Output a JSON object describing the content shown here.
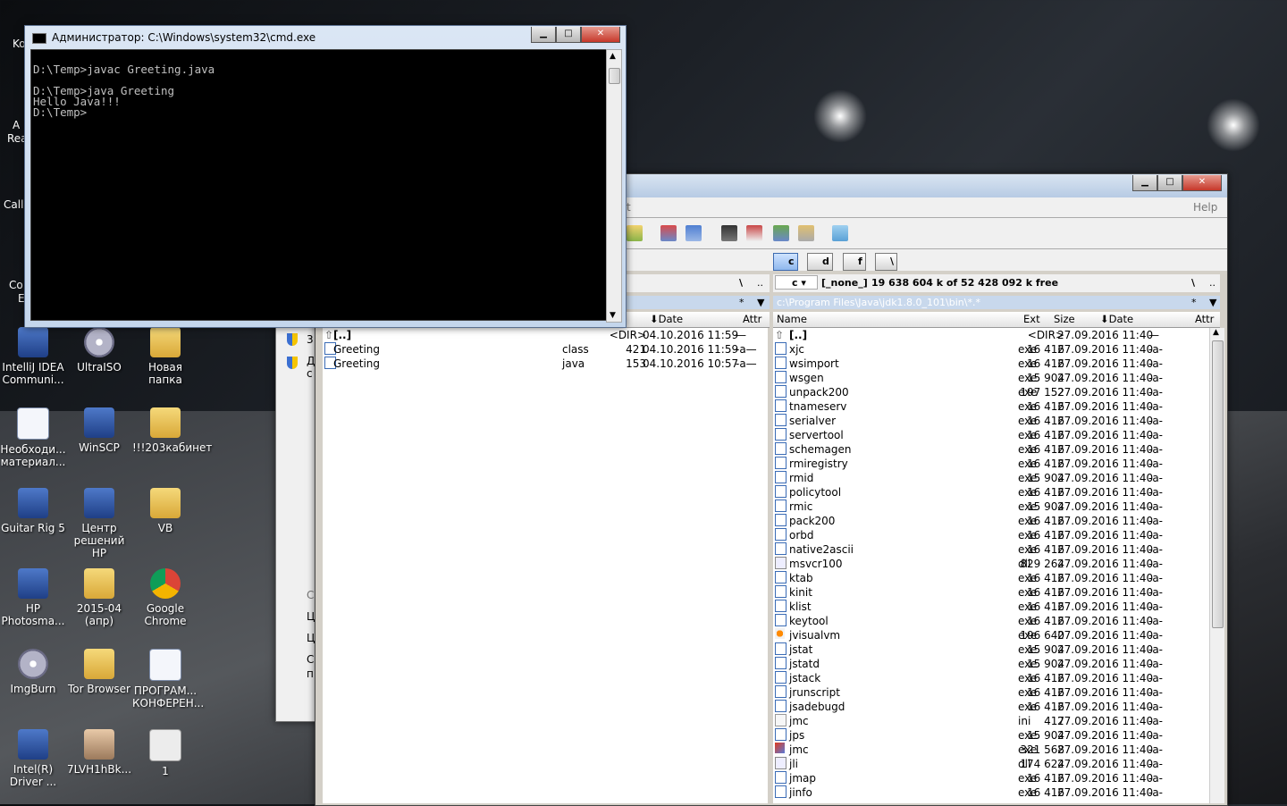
{
  "desktop": {
    "icons": [
      {
        "label": "IntelliJ IDEA Communi...",
        "kind": "app"
      },
      {
        "label": "UltraISO",
        "kind": "disc"
      },
      {
        "label": "Новая папка",
        "kind": "folder"
      },
      {
        "label": "Необходи... материал...",
        "kind": "doc"
      },
      {
        "label": "WinSCP",
        "kind": "app"
      },
      {
        "label": "!!!203кабинет",
        "kind": "folder"
      },
      {
        "label": "Guitar Rig 5",
        "kind": "app"
      },
      {
        "label": "Центр решений HP",
        "kind": "app"
      },
      {
        "label": "VB",
        "kind": "folder"
      },
      {
        "label": "HP Photosma...",
        "kind": "app"
      },
      {
        "label": "2015-04 (апр)",
        "kind": "folder"
      },
      {
        "label": "Google Chrome",
        "kind": "chrome"
      },
      {
        "label": "ImgBurn",
        "kind": "disc"
      },
      {
        "label": "Tor Browser",
        "kind": "folder"
      },
      {
        "label": "ПРОГРАМ... КОНФЕРЕН...",
        "kind": "doc"
      },
      {
        "label": "Intel(R) Driver ...",
        "kind": "app"
      },
      {
        "label": "7LVH1hBk...",
        "kind": "person"
      },
      {
        "label": "1",
        "kind": "mail"
      }
    ],
    "partial_labels": [
      "Ko",
      "A",
      "Rea",
      "Call",
      "Co",
      "E"
    ]
  },
  "cmd": {
    "title": "Администратор: C:\\Windows\\system32\\cmd.exe",
    "output": "D:\\Temp>javac Greeting.java\n\nD:\\Temp>java Greeting\nHello Java!!!\nD:\\Temp>"
  },
  "total_commander": {
    "menu_help": "Help",
    "menu_partial": "t",
    "drives": [
      "c",
      "d",
      "f",
      "\\"
    ],
    "right_drive": {
      "letter": "c",
      "label": "[_none_]",
      "free_text": "19 638 604 k of 52 428 092 k free"
    },
    "right_path": "c:\\Program Files\\Java\\jdk1.8.0_101\\bin\\*.*",
    "nav_root": "\\",
    "nav_up": "..",
    "filter_star": "*",
    "columns": {
      "name": "Name",
      "ext": "Ext",
      "size": "Size",
      "date": "Date",
      "attr": "Attr"
    },
    "left_files": [
      {
        "name": "[..]",
        "ext": "",
        "size": "<DIR>",
        "date": "04.10.2016 11:59",
        "attr": "—",
        "icon": "up"
      },
      {
        "name": "Greeting",
        "ext": "class",
        "size": "421",
        "date": "04.10.2016 11:59",
        "attr": "-a—",
        "icon": "file"
      },
      {
        "name": "Greeting",
        "ext": "java",
        "size": "153",
        "date": "04.10.2016 10:57",
        "attr": "-a—",
        "icon": "file"
      }
    ],
    "right_files": [
      {
        "name": "[..]",
        "ext": "",
        "size": "<DIR>",
        "date": "27.09.2016 11:40",
        "attr": "—",
        "icon": "up"
      },
      {
        "name": "xjc",
        "ext": "exe",
        "size": "16 416",
        "date": "27.09.2016 11:40",
        "attr": "-a-",
        "icon": "file"
      },
      {
        "name": "wsimport",
        "ext": "exe",
        "size": "16 416",
        "date": "27.09.2016 11:40",
        "attr": "-a-",
        "icon": "file"
      },
      {
        "name": "wsgen",
        "ext": "exe",
        "size": "15 904",
        "date": "27.09.2016 11:40",
        "attr": "-a-",
        "icon": "file"
      },
      {
        "name": "unpack200",
        "ext": "exe",
        "size": "197 152",
        "date": "27.09.2016 11:40",
        "attr": "-a-",
        "icon": "file"
      },
      {
        "name": "tnameserv",
        "ext": "exe",
        "size": "16 416",
        "date": "27.09.2016 11:40",
        "attr": "-a-",
        "icon": "file"
      },
      {
        "name": "serialver",
        "ext": "exe",
        "size": "16 416",
        "date": "27.09.2016 11:40",
        "attr": "-a-",
        "icon": "file"
      },
      {
        "name": "servertool",
        "ext": "exe",
        "size": "16 416",
        "date": "27.09.2016 11:40",
        "attr": "-a-",
        "icon": "file"
      },
      {
        "name": "schemagen",
        "ext": "exe",
        "size": "16 416",
        "date": "27.09.2016 11:40",
        "attr": "-a-",
        "icon": "file"
      },
      {
        "name": "rmiregistry",
        "ext": "exe",
        "size": "16 416",
        "date": "27.09.2016 11:40",
        "attr": "-a-",
        "icon": "file"
      },
      {
        "name": "rmid",
        "ext": "exe",
        "size": "15 904",
        "date": "27.09.2016 11:40",
        "attr": "-a-",
        "icon": "file"
      },
      {
        "name": "policytool",
        "ext": "exe",
        "size": "16 416",
        "date": "27.09.2016 11:40",
        "attr": "-a-",
        "icon": "file"
      },
      {
        "name": "rmic",
        "ext": "exe",
        "size": "15 904",
        "date": "27.09.2016 11:40",
        "attr": "-a-",
        "icon": "file"
      },
      {
        "name": "pack200",
        "ext": "exe",
        "size": "16 416",
        "date": "27.09.2016 11:40",
        "attr": "-a-",
        "icon": "file"
      },
      {
        "name": "orbd",
        "ext": "exe",
        "size": "16 416",
        "date": "27.09.2016 11:40",
        "attr": "-a-",
        "icon": "file"
      },
      {
        "name": "native2ascii",
        "ext": "exe",
        "size": "16 416",
        "date": "27.09.2016 11:40",
        "attr": "-a-",
        "icon": "file"
      },
      {
        "name": "msvcr100",
        "ext": "dll",
        "size": "829 264",
        "date": "27.09.2016 11:40",
        "attr": "-a-",
        "icon": "dll"
      },
      {
        "name": "ktab",
        "ext": "exe",
        "size": "16 416",
        "date": "27.09.2016 11:40",
        "attr": "-a-",
        "icon": "file"
      },
      {
        "name": "kinit",
        "ext": "exe",
        "size": "16 416",
        "date": "27.09.2016 11:40",
        "attr": "-a-",
        "icon": "file"
      },
      {
        "name": "klist",
        "ext": "exe",
        "size": "16 416",
        "date": "27.09.2016 11:40",
        "attr": "-a-",
        "icon": "file"
      },
      {
        "name": "keytool",
        "ext": "exe",
        "size": "16 416",
        "date": "27.09.2016 11:40",
        "attr": "-a-",
        "icon": "file"
      },
      {
        "name": "jvisualvm",
        "ext": "exe",
        "size": "196 640",
        "date": "27.09.2016 11:40",
        "attr": "-a-",
        "icon": "jvis"
      },
      {
        "name": "jstat",
        "ext": "exe",
        "size": "15 904",
        "date": "27.09.2016 11:40",
        "attr": "-a-",
        "icon": "file"
      },
      {
        "name": "jstatd",
        "ext": "exe",
        "size": "15 904",
        "date": "27.09.2016 11:40",
        "attr": "-a-",
        "icon": "file"
      },
      {
        "name": "jstack",
        "ext": "exe",
        "size": "16 416",
        "date": "27.09.2016 11:40",
        "attr": "-a-",
        "icon": "file"
      },
      {
        "name": "jrunscript",
        "ext": "exe",
        "size": "16 416",
        "date": "27.09.2016 11:40",
        "attr": "-a-",
        "icon": "file"
      },
      {
        "name": "jsadebugd",
        "ext": "exe",
        "size": "16 416",
        "date": "27.09.2016 11:40",
        "attr": "-a-",
        "icon": "file"
      },
      {
        "name": "jmc",
        "ext": "ini",
        "size": "417",
        "date": "27.09.2016 11:40",
        "attr": "-a-",
        "icon": "ini"
      },
      {
        "name": "jps",
        "ext": "exe",
        "size": "15 904",
        "date": "27.09.2016 11:40",
        "attr": "-a-",
        "icon": "file"
      },
      {
        "name": "jmc",
        "ext": "exe",
        "size": "321 568",
        "date": "27.09.2016 11:40",
        "attr": "-a-",
        "icon": "jmcx"
      },
      {
        "name": "jli",
        "ext": "dll",
        "size": "174 624",
        "date": "27.09.2016 11:40",
        "attr": "-a-",
        "icon": "dll"
      },
      {
        "name": "jmap",
        "ext": "exe",
        "size": "16 416",
        "date": "27.09.2016 11:40",
        "attr": "-a-",
        "icon": "file"
      },
      {
        "name": "jinfo",
        "ext": "exe",
        "size": "16 416",
        "date": "27.09.2016 11:40",
        "attr": "-a-",
        "icon": "file"
      }
    ]
  },
  "bg_window": {
    "partial_texts": [
      "3:",
      "Д",
      "с",
      "С",
      "Ц",
      "Ц",
      "С",
      "п"
    ]
  }
}
